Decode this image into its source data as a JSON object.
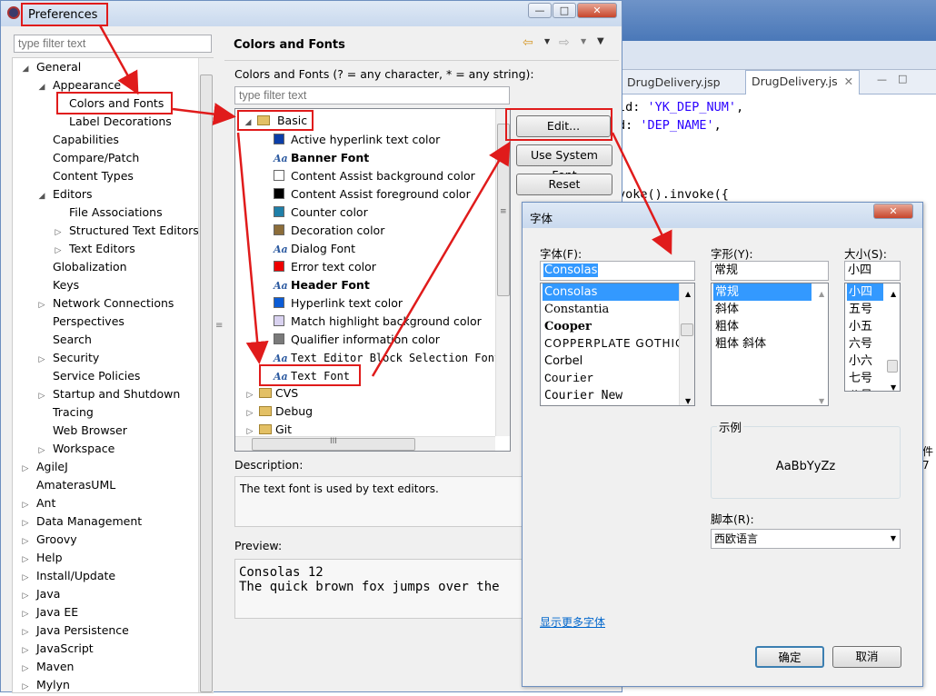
{
  "background_editor": {
    "tabs": [
      "DrugDelivery.jsp",
      "DrugDelivery.js"
    ],
    "code_lines": [
      {
        "pre": "ld: ",
        "str": "'YK_DEP_NUM'",
        "post": ","
      },
      {
        "pre": "d: ",
        "str": "'DEP_NAME'",
        "post": ","
      },
      {
        "pre": "voke().invoke({",
        "str": "",
        "post": ""
      }
    ],
    "fragment": "件7"
  },
  "window": {
    "title": "Preferences",
    "minimize": "—",
    "maximize": "□",
    "close": "✕"
  },
  "left": {
    "filter_placeholder": "type filter text",
    "tree": [
      {
        "label": "General",
        "level": 0,
        "toggle": "open"
      },
      {
        "label": "Appearance",
        "level": 1,
        "toggle": "open"
      },
      {
        "label": "Colors and Fonts",
        "level": 2,
        "toggle": "none"
      },
      {
        "label": "Label Decorations",
        "level": 2,
        "toggle": "none"
      },
      {
        "label": "Capabilities",
        "level": 1,
        "toggle": "none"
      },
      {
        "label": "Compare/Patch",
        "level": 1,
        "toggle": "none"
      },
      {
        "label": "Content Types",
        "level": 1,
        "toggle": "none"
      },
      {
        "label": "Editors",
        "level": 1,
        "toggle": "open"
      },
      {
        "label": "File Associations",
        "level": 2,
        "toggle": "none"
      },
      {
        "label": "Structured Text Editors",
        "level": 2,
        "toggle": "closed"
      },
      {
        "label": "Text Editors",
        "level": 2,
        "toggle": "closed"
      },
      {
        "label": "Globalization",
        "level": 1,
        "toggle": "none"
      },
      {
        "label": "Keys",
        "level": 1,
        "toggle": "none"
      },
      {
        "label": "Network Connections",
        "level": 1,
        "toggle": "closed"
      },
      {
        "label": "Perspectives",
        "level": 1,
        "toggle": "none"
      },
      {
        "label": "Search",
        "level": 1,
        "toggle": "none"
      },
      {
        "label": "Security",
        "level": 1,
        "toggle": "closed"
      },
      {
        "label": "Service Policies",
        "level": 1,
        "toggle": "none"
      },
      {
        "label": "Startup and Shutdown",
        "level": 1,
        "toggle": "closed"
      },
      {
        "label": "Tracing",
        "level": 1,
        "toggle": "none"
      },
      {
        "label": "Web Browser",
        "level": 1,
        "toggle": "none"
      },
      {
        "label": "Workspace",
        "level": 1,
        "toggle": "closed"
      },
      {
        "label": "AgileJ",
        "level": 0,
        "toggle": "closed"
      },
      {
        "label": "AmaterasUML",
        "level": 0,
        "toggle": "none"
      },
      {
        "label": "Ant",
        "level": 0,
        "toggle": "closed"
      },
      {
        "label": "Data Management",
        "level": 0,
        "toggle": "closed"
      },
      {
        "label": "Groovy",
        "level": 0,
        "toggle": "closed"
      },
      {
        "label": "Help",
        "level": 0,
        "toggle": "closed"
      },
      {
        "label": "Install/Update",
        "level": 0,
        "toggle": "closed"
      },
      {
        "label": "Java",
        "level": 0,
        "toggle": "closed"
      },
      {
        "label": "Java EE",
        "level": 0,
        "toggle": "closed"
      },
      {
        "label": "Java Persistence",
        "level": 0,
        "toggle": "closed"
      },
      {
        "label": "JavaScript",
        "level": 0,
        "toggle": "closed"
      },
      {
        "label": "Maven",
        "level": 0,
        "toggle": "closed"
      },
      {
        "label": "Mylyn",
        "level": 0,
        "toggle": "closed"
      }
    ]
  },
  "right": {
    "heading": "Colors and Fonts",
    "hint": "Colors and Fonts (? = any character, * = any string):",
    "filter_placeholder": "type filter text",
    "basic_label": "Basic",
    "items": [
      {
        "label": "Active hyperlink text color",
        "kind": "color",
        "color": "#0b3ea8"
      },
      {
        "label": "Banner Font",
        "kind": "font",
        "style": "bold"
      },
      {
        "label": "Content Assist background color",
        "kind": "color",
        "color": "#ffffff"
      },
      {
        "label": "Content Assist foreground color",
        "kind": "color",
        "color": "#000000"
      },
      {
        "label": "Counter color",
        "kind": "color",
        "color": "#1f7fa8"
      },
      {
        "label": "Decoration color",
        "kind": "color",
        "color": "#8c6d3a"
      },
      {
        "label": "Dialog Font",
        "kind": "font",
        "style": "normal"
      },
      {
        "label": "Error text color",
        "kind": "color",
        "color": "#ee0000"
      },
      {
        "label": "Header Font",
        "kind": "font",
        "style": "bold"
      },
      {
        "label": "Hyperlink text color",
        "kind": "color",
        "color": "#0b5cd6"
      },
      {
        "label": "Match highlight background color",
        "kind": "color",
        "color": "#d9d2f0"
      },
      {
        "label": "Qualifier information color",
        "kind": "color",
        "color": "#7a7a7a"
      },
      {
        "label": "Text Editor Block Selection Font",
        "kind": "font",
        "style": "mono"
      },
      {
        "label": "Text Font",
        "kind": "font",
        "style": "mono"
      }
    ],
    "other_groups": [
      "CVS",
      "Debug",
      "Git"
    ],
    "buttons": {
      "edit": "Edit...",
      "system_font": "Use System Font",
      "reset": "Reset"
    },
    "description_label": "Description:",
    "description": "The text font is used by text editors.",
    "preview_label": "Preview:",
    "preview_lines": [
      "Consolas 12",
      "The quick brown fox jumps over the"
    ]
  },
  "font_dialog": {
    "title": "字体",
    "font_label": "字体(F):",
    "font_value": "Consolas",
    "fonts": [
      "Consolas",
      "Constantia",
      "Cooper",
      "COPPERPLATE GOTHIC",
      "Corbel",
      "Courier",
      "Courier New"
    ],
    "style_label": "字形(Y):",
    "style_value": "常规",
    "styles": [
      "常规",
      "斜体",
      "粗体",
      "粗体 斜体"
    ],
    "size_label": "大小(S):",
    "size_value": "小四",
    "sizes": [
      "小四",
      "五号",
      "小五",
      "六号",
      "小六",
      "七号",
      "八号"
    ],
    "sample_label": "示例",
    "sample_text": "AaBbYyZz",
    "script_label": "脚本(R):",
    "script_value": "西欧语言",
    "more_fonts": "显示更多字体",
    "ok": "确定",
    "cancel": "取消"
  },
  "colors": {
    "accent_red": "#e01b1b",
    "selection_blue": "#3399ff"
  }
}
